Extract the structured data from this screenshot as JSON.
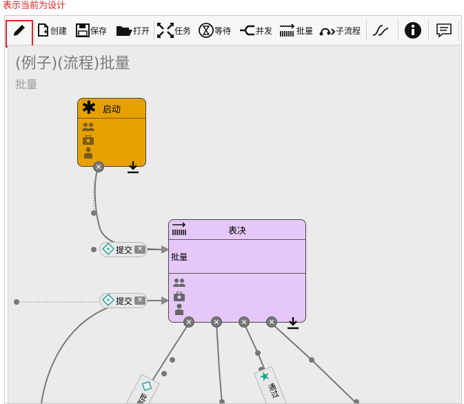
{
  "caption": "表示当前为设计",
  "toolbar": {
    "items": [
      {
        "key": "design",
        "icon": "pencil-icon",
        "label": ""
      },
      {
        "key": "create",
        "icon": "new-doc-icon",
        "label": "创建"
      },
      {
        "key": "save",
        "icon": "floppy-icon",
        "label": "保存"
      },
      {
        "key": "open",
        "icon": "folder-icon",
        "label": "打开"
      },
      {
        "key": "task",
        "icon": "task-icon",
        "label": "任务"
      },
      {
        "key": "wait",
        "icon": "hourglass-icon",
        "label": "等待"
      },
      {
        "key": "parallel",
        "icon": "fork-icon",
        "label": "并发"
      },
      {
        "key": "batch",
        "icon": "batch-icon",
        "label": "批量"
      },
      {
        "key": "subflow",
        "icon": "subflow-icon",
        "label": "子流程"
      },
      {
        "key": "route",
        "icon": "curve-icon",
        "label": ""
      },
      {
        "key": "info",
        "icon": "info-icon",
        "label": ""
      },
      {
        "key": "comment",
        "icon": "comment-icon",
        "label": ""
      }
    ]
  },
  "process": {
    "title": "(例子)(流程)批量",
    "subtitle": "批量"
  },
  "nodes": {
    "start": {
      "title": "启动",
      "color": "#e6a100"
    },
    "vote": {
      "title": "表决",
      "body": "批量",
      "color": "#e5c8f8"
    }
  },
  "connectors": {
    "submit_1": "提交",
    "submit_2": "提交",
    "approve_cut": "通过",
    "batch_cut": "批量"
  },
  "colors": {
    "canvas_bg": "#ebebeb",
    "active_outline": "#d9252b",
    "caption": "#e02020",
    "line": "#777777"
  }
}
